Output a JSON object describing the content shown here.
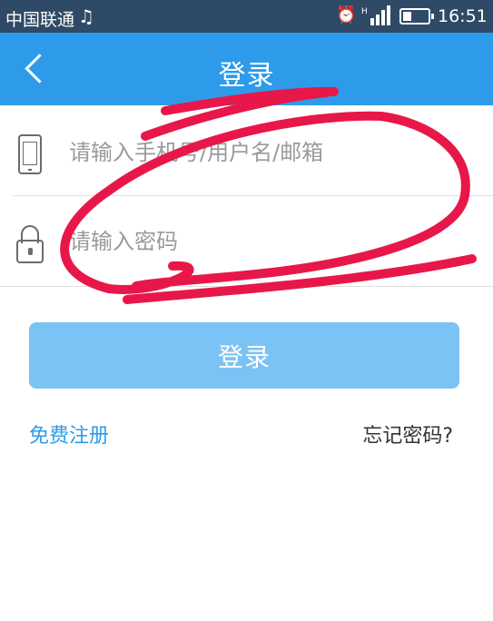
{
  "status_bar": {
    "carrier": "中国联通",
    "music_icon": "music-note-icon",
    "alarm_icon": "alarm-icon",
    "signal_icon": "signal-icon",
    "battery_level": 0.3,
    "time": "16:51"
  },
  "navbar": {
    "back_icon": "chevron-left-icon",
    "title": "登录",
    "background": "#2d9be9"
  },
  "form": {
    "username_placeholder": "请输入手机号/用户名/邮箱",
    "username_icon": "phone-icon",
    "password_placeholder": "请输入密码",
    "password_icon": "lock-icon"
  },
  "actions": {
    "login_label": "登录",
    "register_label": "免费注册",
    "forgot_label": "忘记密码?"
  },
  "annotation": {
    "scribble_color": "#e8174a"
  }
}
